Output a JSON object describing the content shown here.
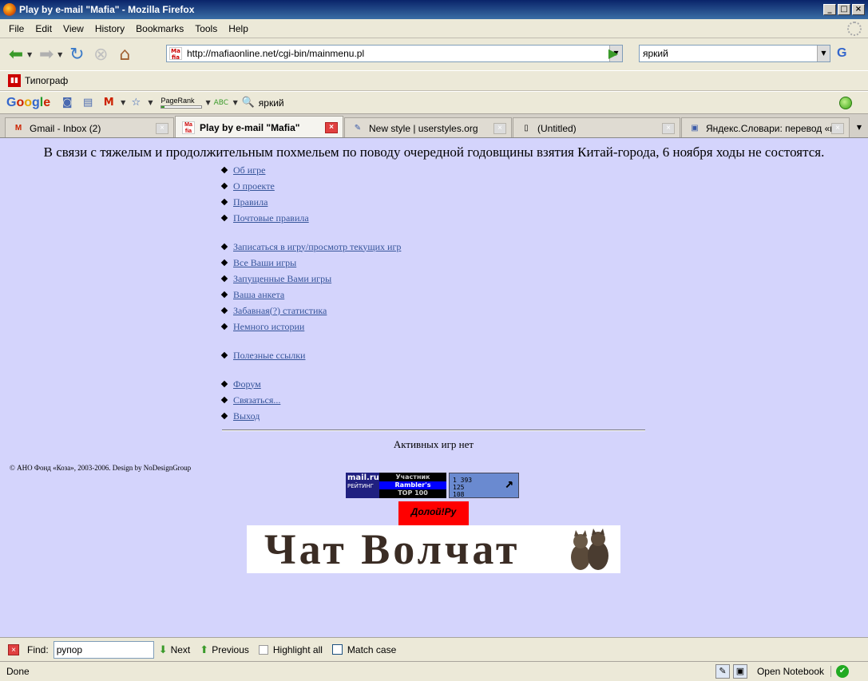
{
  "window": {
    "title": "Play by e-mail \"Mafia\" - Mozilla Firefox",
    "controls": [
      "_",
      "□",
      "×"
    ]
  },
  "menubar": {
    "items": [
      "File",
      "Edit",
      "View",
      "History",
      "Bookmarks",
      "Tools",
      "Help"
    ]
  },
  "navbar": {
    "url": "http://mafiaonline.net/cgi-bin/mainmenu.pl",
    "favicon_text": "Ma fia",
    "search_query": "яркий",
    "search_engine_letter": "G"
  },
  "bookmarks": {
    "items": [
      {
        "label": "Типограф"
      }
    ]
  },
  "google_toolbar": {
    "logo": [
      "G",
      "o",
      "o",
      "g",
      "l",
      "e"
    ],
    "pagerank_label": "PageRank",
    "spell_label": "ABC",
    "search_label": "яркий"
  },
  "tabs": [
    {
      "label": "Gmail - Inbox (2)",
      "icon": "gmail-icon",
      "active": false
    },
    {
      "label": "Play by e-mail \"Mafia\"",
      "icon": "mafia-icon",
      "active": true
    },
    {
      "label": "New style | userstyles.org",
      "icon": "pencil-icon",
      "active": false
    },
    {
      "label": "(Untitled)",
      "icon": "page-icon",
      "active": false
    },
    {
      "label": "Яндекс.Словари: перевод «г...",
      "icon": "yandex-icon",
      "active": false
    }
  ],
  "page": {
    "announcement": "В связи с тяжелым и продолжительным похмельем по поводу очередной годовщины взятия Китай-города, 6 ноября ходы не состоятся.",
    "menu_groups": [
      [
        "Об игре",
        "О проекте",
        "Правила",
        "Почтовые правила"
      ],
      [
        "Записаться в игру/просмотр текущих игр",
        "Все Ваши игры",
        "Запущенные Вами игры",
        "Ваша анкета",
        "Забавная(?) статистика",
        "Немного истории"
      ],
      [
        "Полезные ссылки"
      ],
      [
        "Форум",
        "Связаться...",
        "Выход"
      ]
    ],
    "no_active_games": "Активных игр нет",
    "copyright": "© АНО Фонд «Коза», 2003-2006. Design by NoDesignGroup",
    "counter_mailru": {
      "brand": "mail.ru",
      "rating": "РЕЙТИНГ",
      "line1": "Участник",
      "line2": "Rambler's",
      "line3": "TOP 100"
    },
    "counter_stats": {
      "values": [
        "1 393",
        "125",
        "108"
      ]
    },
    "dolojru": "Долой!Ру",
    "chat_banner": "Чат Волчат"
  },
  "findbar": {
    "find_label": "Find:",
    "query": "рупор",
    "next_label": "Next",
    "previous_label": "Previous",
    "highlight_label": "Highlight all",
    "matchcase_label": "Match case"
  },
  "statusbar": {
    "status": "Done",
    "notebook_label": "Open Notebook"
  }
}
